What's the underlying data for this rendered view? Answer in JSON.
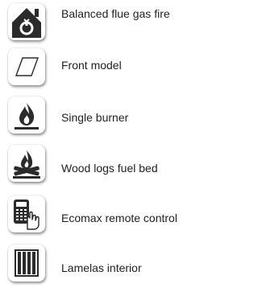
{
  "features": [
    {
      "icon": "house-fire-icon",
      "label": "Balanced flue gas fire"
    },
    {
      "icon": "front-panel-icon",
      "label": "Front model"
    },
    {
      "icon": "flame-icon",
      "label": "Single burner"
    },
    {
      "icon": "wood-logs-fire-icon",
      "label": "Wood logs fuel bed"
    },
    {
      "icon": "remote-control-icon",
      "label": "Ecomax remote control"
    },
    {
      "icon": "lamellas-icon",
      "label": "Lamelas interior"
    }
  ],
  "colors": {
    "icon_dark": "#2b2b2b",
    "text": "#222222",
    "background": "#ffffff"
  }
}
